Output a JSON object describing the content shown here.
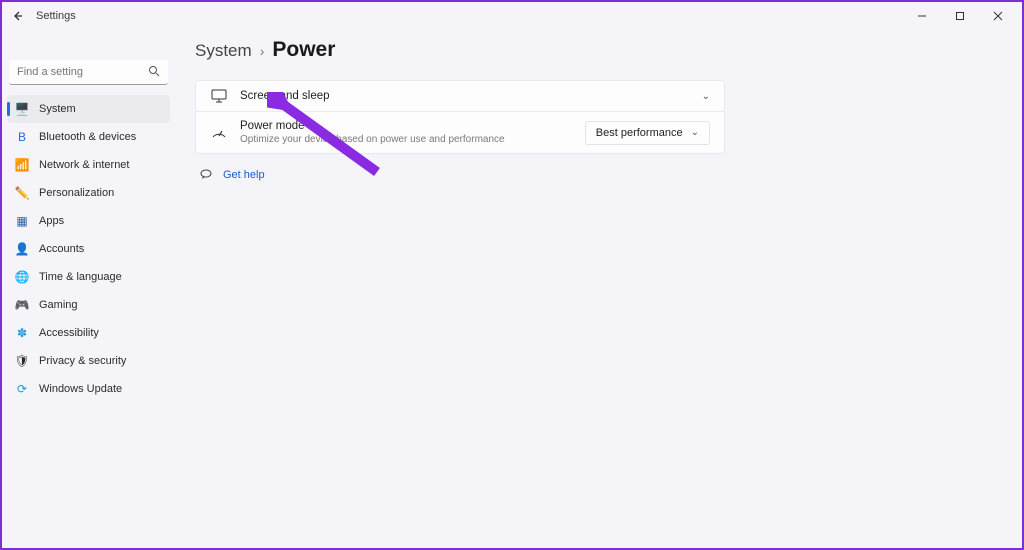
{
  "window": {
    "title": "Settings"
  },
  "search": {
    "placeholder": "Find a setting"
  },
  "nav": [
    {
      "label": "System",
      "icon": "🖥️",
      "active": true
    },
    {
      "label": "Bluetooth & devices",
      "icon": "B",
      "iconColor": "#1f6cde"
    },
    {
      "label": "Network & internet",
      "icon": "📶",
      "iconColor": "#1f6cde"
    },
    {
      "label": "Personalization",
      "icon": "✏️"
    },
    {
      "label": "Apps",
      "icon": "▦",
      "iconColor": "#2a5fa0"
    },
    {
      "label": "Accounts",
      "icon": "👤"
    },
    {
      "label": "Time & language",
      "icon": "🌐",
      "iconColor": "#2a9ad6"
    },
    {
      "label": "Gaming",
      "icon": "🎮"
    },
    {
      "label": "Accessibility",
      "icon": "✽",
      "iconColor": "#2a9ad6"
    },
    {
      "label": "Privacy & security",
      "icon": "🛡"
    },
    {
      "label": "Windows Update",
      "icon": "⟳",
      "iconColor": "#1f9ad6"
    }
  ],
  "breadcrumb": {
    "parent": "System",
    "current": "Power"
  },
  "rows": {
    "screen_sleep": {
      "title": "Screen and sleep"
    },
    "power_mode": {
      "title": "Power mode",
      "subtitle": "Optimize your device based on power use and performance",
      "selected": "Best performance"
    }
  },
  "help": {
    "label": "Get help"
  },
  "arrow": {
    "color": "#8a2be2"
  }
}
